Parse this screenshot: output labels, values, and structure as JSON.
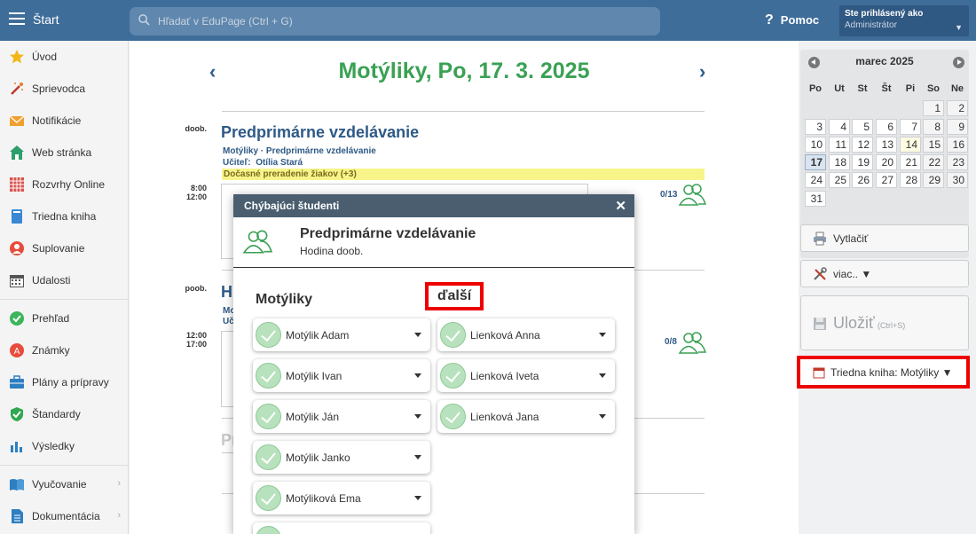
{
  "topbar": {
    "start_label": "Štart",
    "search_placeholder": "Hľadať v EduPage (Ctrl + G)",
    "help_label": "Pomoc",
    "user_line1": "Ste prihlásený ako",
    "user_line2": "Administrátor"
  },
  "sidebar": {
    "items": [
      {
        "label": "Úvod",
        "icon": "star-icon"
      },
      {
        "label": "Sprievodca",
        "icon": "magic-wand-icon"
      },
      {
        "label": "Notifikácie",
        "icon": "envelope-icon"
      },
      {
        "label": "Web stránka",
        "icon": "house-icon"
      },
      {
        "label": "Rozvrhy Online",
        "icon": "timetable-grid-icon"
      },
      {
        "label": "Triedna kniha",
        "icon": "book-icon"
      },
      {
        "label": "Suplovanie",
        "icon": "person-icon"
      },
      {
        "label": "Udalosti",
        "icon": "calendar-icon"
      },
      {
        "label": "Prehľad",
        "icon": "check-circle-icon"
      },
      {
        "label": "Známky",
        "icon": "grade-icon"
      },
      {
        "label": "Plány a prípravy",
        "icon": "briefcase-icon"
      },
      {
        "label": "Štandardy",
        "icon": "shield-check-icon"
      },
      {
        "label": "Výsledky",
        "icon": "bar-chart-icon"
      },
      {
        "label": "Vyučovanie",
        "icon": "open-book-icon"
      },
      {
        "label": "Dokumentácia",
        "icon": "document-icon"
      }
    ]
  },
  "main": {
    "title": "Motýliky, Po, 17. 3. 2025",
    "lesson1": {
      "period": "doob.",
      "time_start": "8:00",
      "time_end": "12:00",
      "title": "Predprimárne vzdelávanie",
      "sub1": "Motýliky · Predprimárne vzdelávanie",
      "teacher_label": "Učiteľ:",
      "teacher": "Otília Stará",
      "notice": "Dočasné preradenie žiakov (+3)",
      "count": "0/13"
    },
    "lesson2": {
      "period": "poob.",
      "time_start": "12:00",
      "time_end": "17:00",
      "title_fragment": "H",
      "sub1_fragment": "Mo",
      "sub2_fragment": "Uč",
      "count": "0/8"
    },
    "lesson3": {
      "title_fragment": "Pr"
    }
  },
  "modal": {
    "header": "Chýbajúci študenti",
    "close": "✕",
    "info_title": "Predprimárne vzdelávanie",
    "info_sub": "Hodina doob.",
    "col1_title": "Motýliky",
    "col2_title": "ďalší",
    "col1_students": [
      "Motýlik Adam",
      "Motýlik Ivan",
      "Motýlik Ján",
      "Motýlik Janko",
      "Motýliková Ema"
    ],
    "col2_students": [
      "Lienková Anna",
      "Lienková Iveta",
      "Lienková Jana"
    ]
  },
  "calendar": {
    "month": "marec 2025",
    "weekdays": [
      "Po",
      "Ut",
      "St",
      "Št",
      "Pi",
      "So",
      "Ne"
    ],
    "weeks": [
      [
        "",
        "",
        "",
        "",
        "",
        "1",
        "2"
      ],
      [
        "3",
        "4",
        "5",
        "6",
        "7",
        "8",
        "9"
      ],
      [
        "10",
        "11",
        "12",
        "13",
        "14",
        "15",
        "16"
      ],
      [
        "17",
        "18",
        "19",
        "20",
        "21",
        "22",
        "23"
      ],
      [
        "24",
        "25",
        "26",
        "27",
        "28",
        "29",
        "30"
      ],
      [
        "31",
        "",
        "",
        "",
        "",
        "",
        ""
      ]
    ],
    "selected_day": "17",
    "marked_day": "14"
  },
  "right": {
    "print_label": "Vytlačiť",
    "more_label": "viac.. ▼",
    "save_label": "Uložiť",
    "save_shortcut": "(Ctrl+S)",
    "classbook_label": "Triedna kniha: Motýliky ▼"
  },
  "colors": {
    "topbar": "#3e6d99",
    "title_green": "#3aa154",
    "link_blue": "#2e5a87",
    "highlight_red": "#ee0000",
    "notice_yellow": "#f7f48a"
  }
}
